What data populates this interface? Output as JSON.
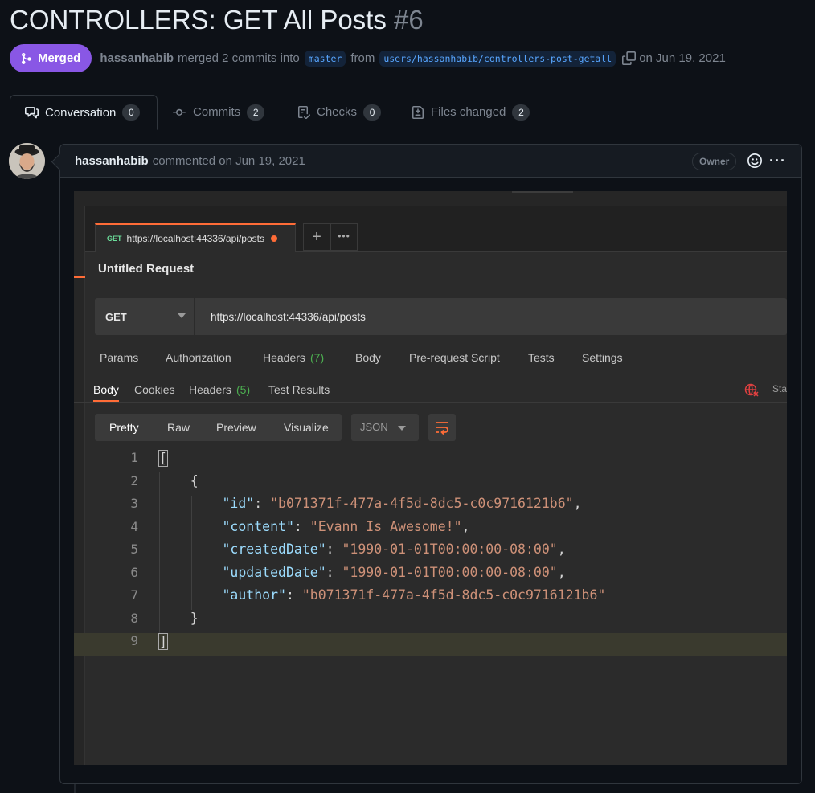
{
  "pr": {
    "title": "CONTROLLERS: GET All Posts",
    "number": "#6",
    "status": "Merged",
    "author": "hassanhabib",
    "merged_text": "merged 2 commits into",
    "base_branch": "master",
    "from_text": "from",
    "head_branch": "users/hassanhabib/controllers-post-getall",
    "date_text": "on Jun 19, 2021",
    "status_color": "#8957e5"
  },
  "tabs": [
    {
      "label": "Conversation",
      "count": "0",
      "icon": "comment-icon"
    },
    {
      "label": "Commits",
      "count": "2",
      "icon": "commit-icon"
    },
    {
      "label": "Checks",
      "count": "0",
      "icon": "checks-icon"
    },
    {
      "label": "Files changed",
      "count": "2",
      "icon": "file-diff-icon"
    }
  ],
  "comment": {
    "author": "hassanhabib",
    "text": "commented on Jun 19, 2021",
    "role_badge": "Owner"
  },
  "postman": {
    "tab_method": "GET",
    "tab_url": "https://localhost:44336/api/posts",
    "request_name": "Untitled Request",
    "method": "GET",
    "url": "https://localhost:44336/api/posts",
    "request_tabs": [
      "Params",
      "Authorization",
      "Headers",
      "(7)",
      "Body",
      "Pre-request Script",
      "Tests",
      "Settings"
    ],
    "response_tabs": [
      "Body",
      "Cookies",
      "Headers",
      "(5)",
      "Test Results"
    ],
    "status_partial": "Sta",
    "format_buttons": [
      "Pretty",
      "Raw",
      "Preview",
      "Visualize"
    ],
    "format_select": "JSON",
    "code_lines": [
      {
        "n": "1",
        "t": "["
      },
      {
        "n": "2",
        "t": "    {"
      },
      {
        "n": "3",
        "k": "\"id\"",
        "v": "\"b071371f-477a-4f5d-8dc5-c0c9716121b6\"",
        "end": ","
      },
      {
        "n": "4",
        "k": "\"content\"",
        "v": "\"Evann Is Awesome!\"",
        "end": ","
      },
      {
        "n": "5",
        "k": "\"createdDate\"",
        "v": "\"1990-01-01T00:00:00-08:00\"",
        "end": ","
      },
      {
        "n": "6",
        "k": "\"updatedDate\"",
        "v": "\"1990-01-01T00:00:00-08:00\"",
        "end": ","
      },
      {
        "n": "7",
        "k": "\"author\"",
        "v": "\"b071371f-477a-4f5d-8dc5-c0c9716121b6\"",
        "end": ""
      },
      {
        "n": "8",
        "t": "    }"
      },
      {
        "n": "9",
        "t": "]"
      }
    ]
  }
}
